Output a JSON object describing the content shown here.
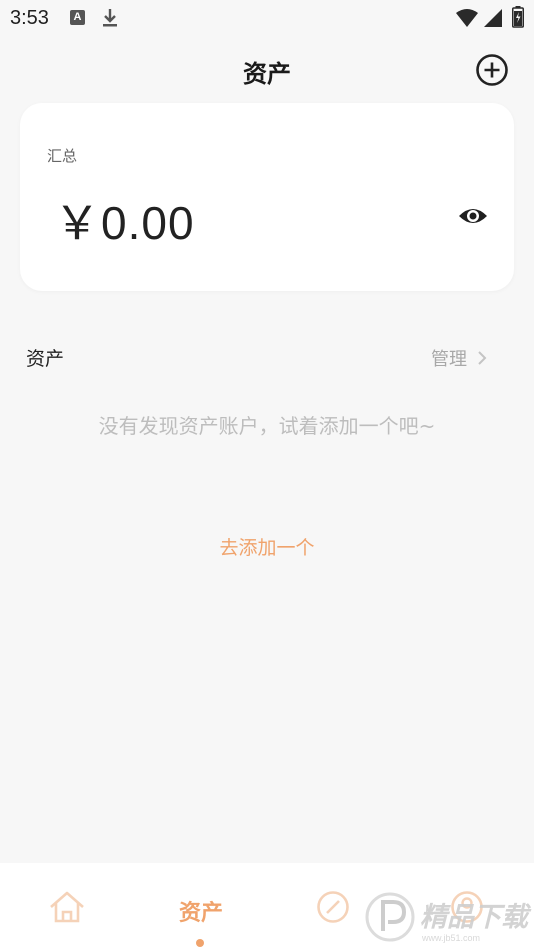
{
  "status_bar": {
    "time": "3:53",
    "icons": [
      "a-icon",
      "download-icon",
      "wifi-icon",
      "signal-icon",
      "battery-icon"
    ]
  },
  "header": {
    "title": "资产",
    "add_icon": "plus-circle-icon"
  },
  "summary": {
    "label": "汇总",
    "amount": "￥0.00",
    "visibility_icon": "eye-icon"
  },
  "assets_section": {
    "title": "资产",
    "manage_label": "管理",
    "chevron_icon": "chevron-right-icon"
  },
  "empty_state": {
    "message": "没有发现资产账户，试着添加一个吧~",
    "action_label": "去添加一个"
  },
  "bottom_nav": {
    "items": [
      {
        "icon": "home-icon",
        "label": ""
      },
      {
        "icon": "",
        "label": "资产",
        "active": true
      },
      {
        "icon": "stats-icon",
        "label": ""
      },
      {
        "icon": "user-icon",
        "label": ""
      }
    ]
  },
  "watermark": {
    "text": "精品下载"
  },
  "colors": {
    "accent": "#f0a36c",
    "background": "#f7f7f7",
    "card": "#ffffff",
    "muted_text": "#bdbdbd"
  }
}
